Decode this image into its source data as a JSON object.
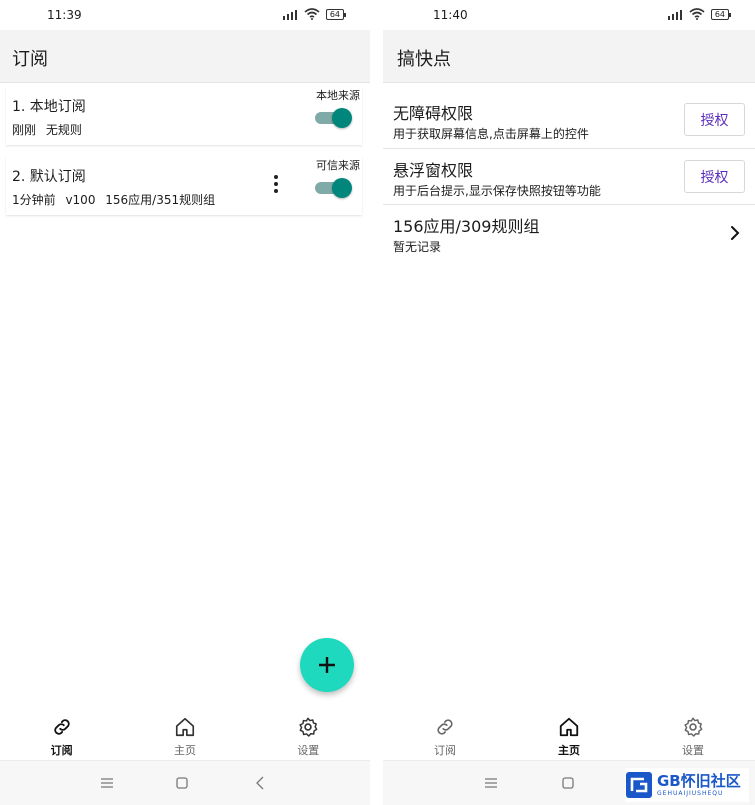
{
  "left": {
    "status_time": "11:39",
    "battery": "64",
    "title": "订阅",
    "cards": [
      {
        "name": "1. 本地订阅",
        "meta": "刚刚 无规则",
        "tag": "本地来源",
        "enabled": true
      },
      {
        "name": "2. 默认订阅",
        "meta": "1分钟前 v100 156应用/351规则组",
        "tag": "可信来源",
        "enabled": true
      }
    ],
    "nav": [
      {
        "label": "订阅",
        "icon": "link-icon",
        "active": true
      },
      {
        "label": "主页",
        "icon": "home-icon",
        "active": false
      },
      {
        "label": "设置",
        "icon": "gear-icon",
        "active": false
      }
    ]
  },
  "right": {
    "status_time": "11:40",
    "battery": "64",
    "title": "搞快点",
    "rows": [
      {
        "title": "无障碍权限",
        "subtitle": "用于获取屏幕信息,点击屏幕上的控件",
        "button": "授权"
      },
      {
        "title": "悬浮窗权限",
        "subtitle": "用于后台提示,显示保存快照按钮等功能",
        "button": "授权"
      },
      {
        "title": "156应用/309规则组",
        "subtitle": "暂无记录"
      }
    ],
    "nav": [
      {
        "label": "订阅",
        "icon": "link-icon",
        "active": false
      },
      {
        "label": "主页",
        "icon": "home-icon",
        "active": true
      },
      {
        "label": "设置",
        "icon": "gear-icon",
        "active": false
      }
    ]
  },
  "watermark": {
    "title": "GB怀旧社区",
    "subtitle": "GEHUAIJIUSHEQU"
  },
  "colors": {
    "accent": "#00867b",
    "track": "#80aaa7",
    "fab": "#1ed9be",
    "button_text": "#5b2ebd"
  }
}
